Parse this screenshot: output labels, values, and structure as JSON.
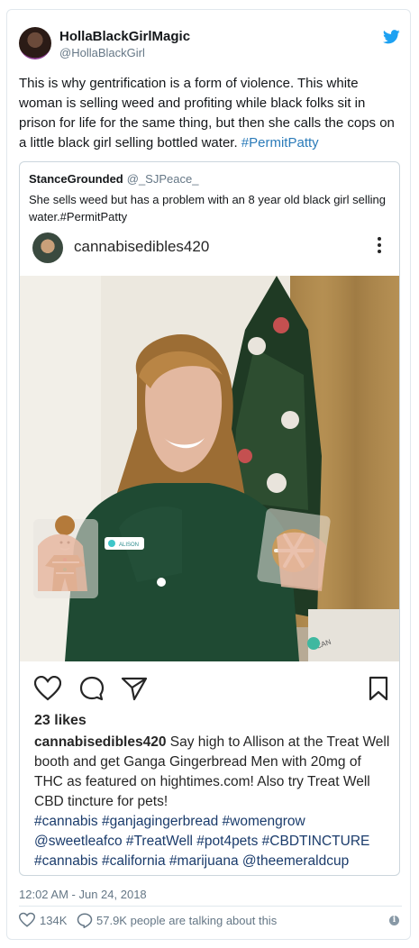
{
  "author": {
    "name": "HollaBlackGirlMagic",
    "handle": "@HollaBlackGirl"
  },
  "tweet": {
    "text": "This is why gentrification is a form of violence. This white woman is selling weed and profiting while black folks sit in prison for life for the same thing, but then she calls the cops on a little black girl selling bottled water. ",
    "hashtag": "#PermitPatty"
  },
  "quoted": {
    "name": "StanceGrounded",
    "handle": "@_SJPeace_",
    "text": "She sells weed but has a problem with an 8 year old black girl selling water.#PermitPatty"
  },
  "instagram": {
    "username": "cannabisedibles420",
    "likes": "23 likes",
    "caption_user": "cannabisedibles420",
    "caption_text": " Say high to Allison at the Treat Well booth and get Ganga Gingerbread Men with 20mg of THC as featured on hightimes.com! Also try Treat Well CBD tincture for pets!",
    "caption_tags": "#cannabis #ganjagingerbread #womengrow @sweetleafco #TreatWell #pot4pets #CBDTINCTURE #cannabis #california #marijuana @theemeraldcup",
    "name_tag": "ALISON",
    "box_text": "CAN"
  },
  "footer": {
    "timestamp": "12:02 AM - Jun 24, 2018",
    "like_count": "134K",
    "talking": "57.9K people are talking about this",
    "info_glyph": "i"
  },
  "colors": {
    "link": "#2b7bb9",
    "twitter_blue": "#1da1f2",
    "muted": "#657786"
  }
}
